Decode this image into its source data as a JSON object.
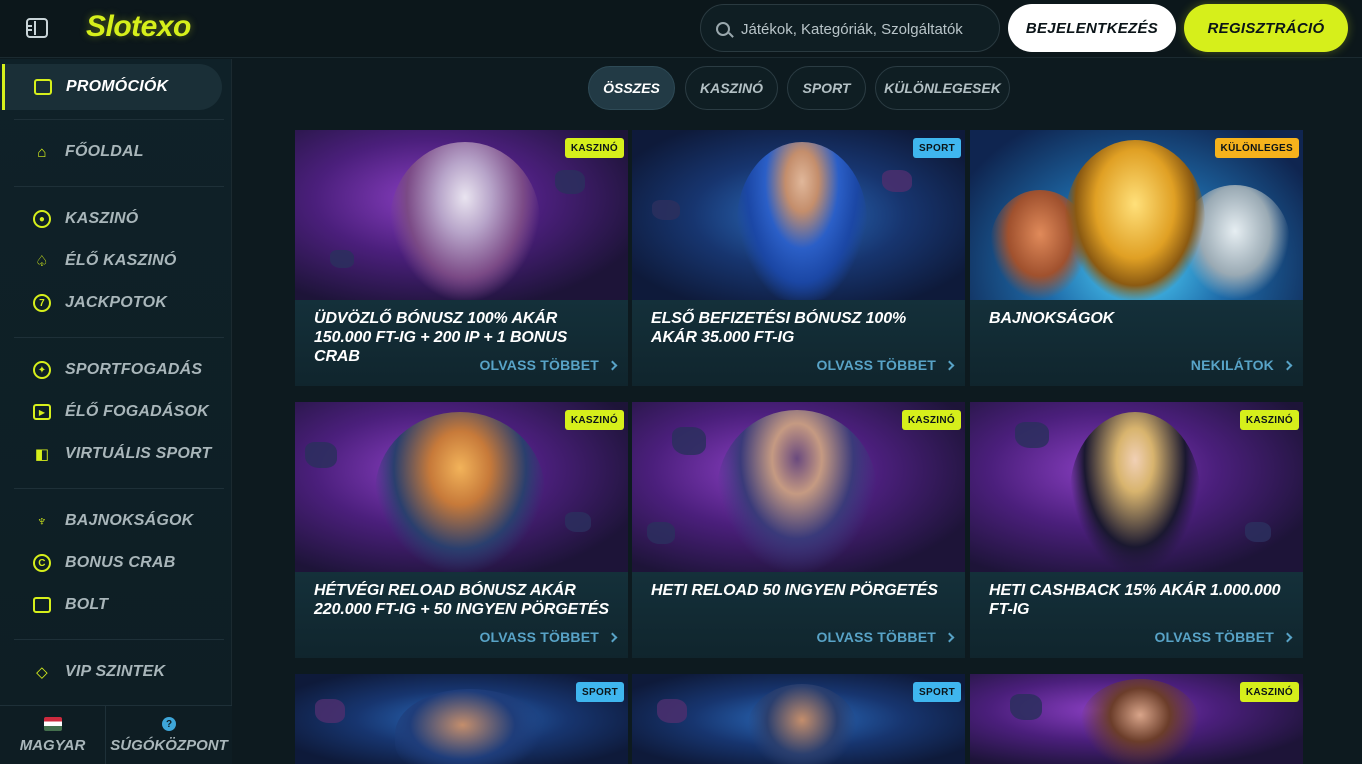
{
  "header": {
    "logo": "Slotexo",
    "search_placeholder": "Játékok, Kategóriák, Szolgáltatók",
    "login_label": "BEJELENTKEZÉS",
    "register_label": "REGISZTRÁCIÓ"
  },
  "sidebar": {
    "items": [
      {
        "label": "PROMÓCIÓK",
        "icon": "gift-icon",
        "active": true
      },
      {
        "label": "FŐOLDAL",
        "icon": "home-icon"
      },
      {
        "label": "KASZINÓ",
        "icon": "casino-chip-icon"
      },
      {
        "label": "ÉLŐ KASZINÓ",
        "icon": "spade-icon"
      },
      {
        "label": "JACKPOTOK",
        "icon": "seven-icon"
      },
      {
        "label": "SPORTFOGADÁS",
        "icon": "football-icon"
      },
      {
        "label": "ÉLŐ FOGADÁSOK",
        "icon": "play-icon"
      },
      {
        "label": "VIRTUÁLIS SPORT",
        "icon": "gamepad-icon"
      },
      {
        "label": "BAJNOKSÁGOK",
        "icon": "trophy-icon"
      },
      {
        "label": "BONUS CRAB",
        "icon": "crab-icon"
      },
      {
        "label": "BOLT",
        "icon": "shop-icon"
      },
      {
        "label": "VIP SZINTEK",
        "icon": "diamond-icon"
      }
    ],
    "footer": {
      "language": "MAGYAR",
      "help": "SÚGÓKÖZPONT"
    }
  },
  "filters": [
    "ÖSSZES",
    "KASZINÓ",
    "SPORT",
    "KÜLÖNLEGESEK"
  ],
  "active_filter": "ÖSSZES",
  "cards": [
    {
      "title": "ÜDVÖZLŐ BÓNUSZ 100% AKÁR 150.000 FT-IG + 200 IP + 1 BONUS CRAB",
      "badge": "KASZINÓ",
      "link": "OLVASS TÖBBET"
    },
    {
      "title": "ELSŐ BEFIZETÉSI BÓNUSZ 100% AKÁR 35.000 FT-IG",
      "badge": "SPORT",
      "link": "OLVASS TÖBBET"
    },
    {
      "title": "BAJNOKSÁGOK",
      "badge": "KÜLÖNLEGES",
      "link": "NEKILÁTOK"
    },
    {
      "title": "HÉTVÉGI RELOAD BÓNUSZ AKÁR 220.000 FT-IG + 50 INGYEN PÖRGETÉS",
      "badge": "KASZINÓ",
      "link": "OLVASS TÖBBET"
    },
    {
      "title": "HETI RELOAD 50 INGYEN PÖRGETÉS",
      "badge": "KASZINÓ",
      "link": "OLVASS TÖBBET"
    },
    {
      "title": "HETI CASHBACK 15% AKÁR 1.000.000 FT-IG",
      "badge": "KASZINÓ",
      "link": "OLVASS TÖBBET"
    },
    {
      "title": "",
      "badge": "SPORT",
      "link": ""
    },
    {
      "title": "",
      "badge": "SPORT",
      "link": ""
    },
    {
      "title": "",
      "badge": "KASZINÓ",
      "link": ""
    }
  ],
  "colors": {
    "accent": "#d6ef1b",
    "background": "#0d1a1f",
    "sport_badge": "#3fb6ef",
    "special_badge": "#f5b21c",
    "link": "#58a3c7"
  }
}
